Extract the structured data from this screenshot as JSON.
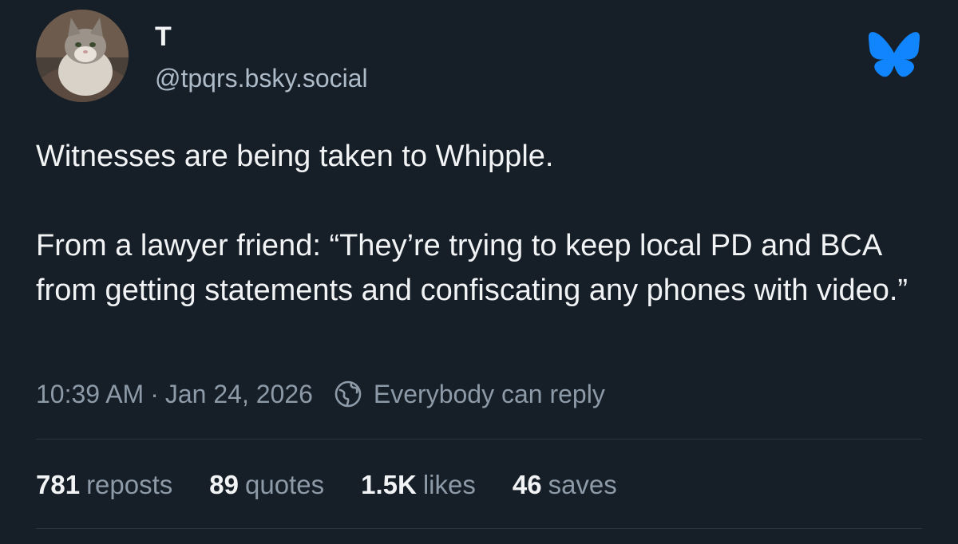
{
  "author": {
    "display_name": "T",
    "handle": "@tpqrs.bsky.social",
    "avatar_icon": "cat-avatar"
  },
  "brand": {
    "icon": "bluesky-butterfly-icon",
    "color": "#1185fe"
  },
  "post": {
    "paragraph_1": "Witnesses are being taken to Whipple.",
    "paragraph_2": "From a lawyer friend: “They’re trying to keep local PD and BCA from getting statements and confiscating any phones with video.”",
    "time": "10:39 AM",
    "separator": "·",
    "date": "Jan 24, 2026",
    "reply_setting": "Everybody can reply"
  },
  "stats": {
    "reposts_count": "781",
    "reposts_label": "reposts",
    "quotes_count": "89",
    "quotes_label": "quotes",
    "likes_count": "1.5K",
    "likes_label": "likes",
    "saves_count": "46",
    "saves_label": "saves"
  },
  "colors": {
    "background": "#161e27",
    "text_primary": "#f1f3f5",
    "text_secondary": "#8d9aa8"
  }
}
